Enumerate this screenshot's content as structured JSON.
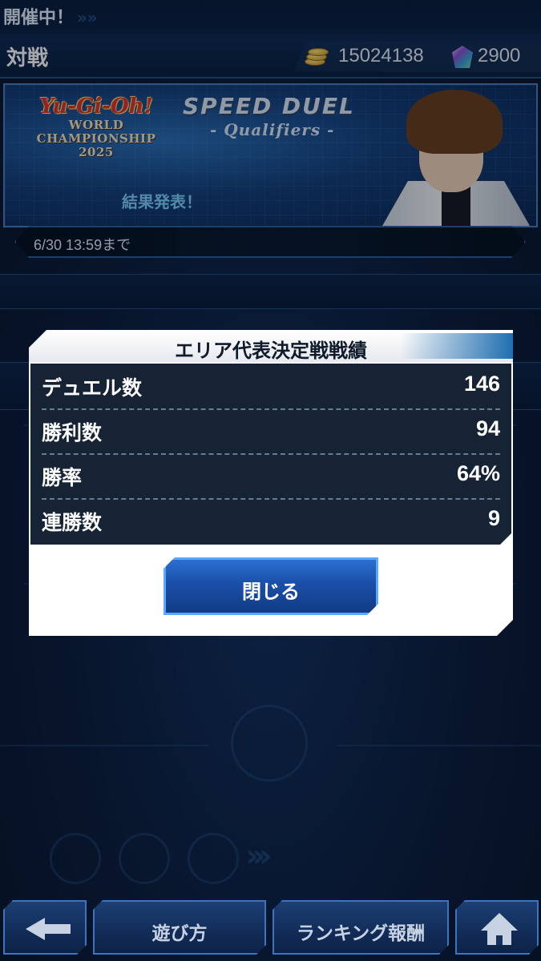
{
  "ticker": {
    "text": "開催中！",
    "arrows": "»»"
  },
  "header": {
    "title": "対戦",
    "coins": "15024138",
    "gems": "2900"
  },
  "banner": {
    "logo_brand": "Yu-Gi-Oh!",
    "logo_line1": "WORLD",
    "logo_line2": "CHAMPIONSHIP",
    "logo_line3": "2025",
    "event_title": "SPEED DUEL",
    "event_subtitle": "- Qualifiers -",
    "result_label": "結果発表！",
    "deadline": "6/30 13:59まで"
  },
  "modal": {
    "title": "エリア代表決定戦戦績",
    "stats": [
      {
        "label": "デュエル数",
        "value": "146"
      },
      {
        "label": "勝利数",
        "value": "94"
      },
      {
        "label": "勝率",
        "value": "64%"
      },
      {
        "label": "連勝数",
        "value": "9"
      }
    ],
    "close_label": "閉じる"
  },
  "bottom_nav": {
    "how_to_play": "遊び方",
    "ranking_rewards": "ランキング報酬"
  },
  "colors": {
    "background": "#0c1d3b",
    "accent": "#1a4fa8",
    "panel": "#152335",
    "result_text": "#7fd0ff"
  },
  "icons": {
    "coins": "coin-stack-icon",
    "gems": "gem-icon",
    "back": "back-arrow-icon",
    "home": "home-icon"
  }
}
